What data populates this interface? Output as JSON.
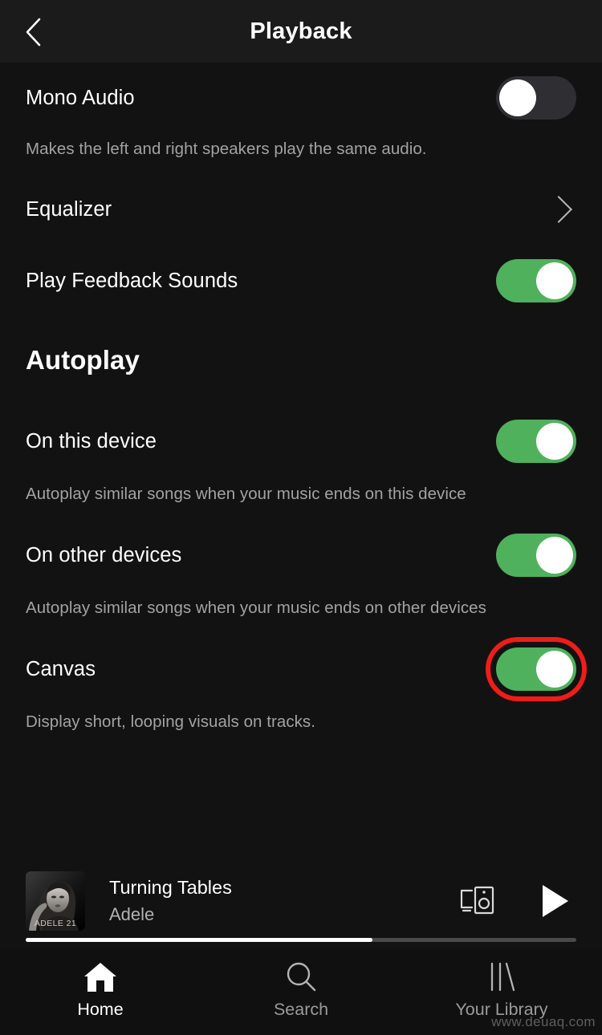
{
  "header": {
    "title": "Playback",
    "back_icon": "chevron-left-icon"
  },
  "settings": [
    {
      "label": "Mono Audio",
      "description": "Makes the left and right speakers play the same audio.",
      "control": "toggle",
      "state": "off"
    },
    {
      "label": "Equalizer",
      "description": "",
      "control": "chevron",
      "state": ""
    },
    {
      "label": "Play Feedback Sounds",
      "description": "",
      "control": "toggle",
      "state": "on"
    }
  ],
  "autoplay_section": {
    "title": "Autoplay",
    "items": [
      {
        "label": "On this device",
        "description": "Autoplay similar songs when your music ends on this device",
        "control": "toggle",
        "state": "on"
      },
      {
        "label": "On other devices",
        "description": "Autoplay similar songs when your music ends on other devices",
        "control": "toggle",
        "state": "on"
      },
      {
        "label": "Canvas",
        "description": "Display short, looping visuals on tracks.",
        "control": "toggle",
        "state": "on",
        "highlighted": true
      }
    ]
  },
  "now_playing": {
    "title": "Turning Tables",
    "artist": "Adele",
    "album_art_caption": "ADELE 21",
    "devices_icon": "connect-to-device-icon",
    "play_icon": "play-icon",
    "progress_percent": 63
  },
  "bottom_nav": [
    {
      "label": "Home",
      "icon": "home-icon",
      "active": true
    },
    {
      "label": "Search",
      "icon": "search-icon",
      "active": false
    },
    {
      "label": "Your Library",
      "icon": "library-icon",
      "active": false
    }
  ],
  "watermark": "www.deuaq.com",
  "colors": {
    "background": "#121212",
    "header_background": "#1b1b1b",
    "toggle_on": "#4fb15c",
    "toggle_off": "#2e2e33",
    "highlight_ring": "#ee1d18",
    "primary_text": "#ffffff",
    "secondary_text": "#a2a2a2"
  }
}
